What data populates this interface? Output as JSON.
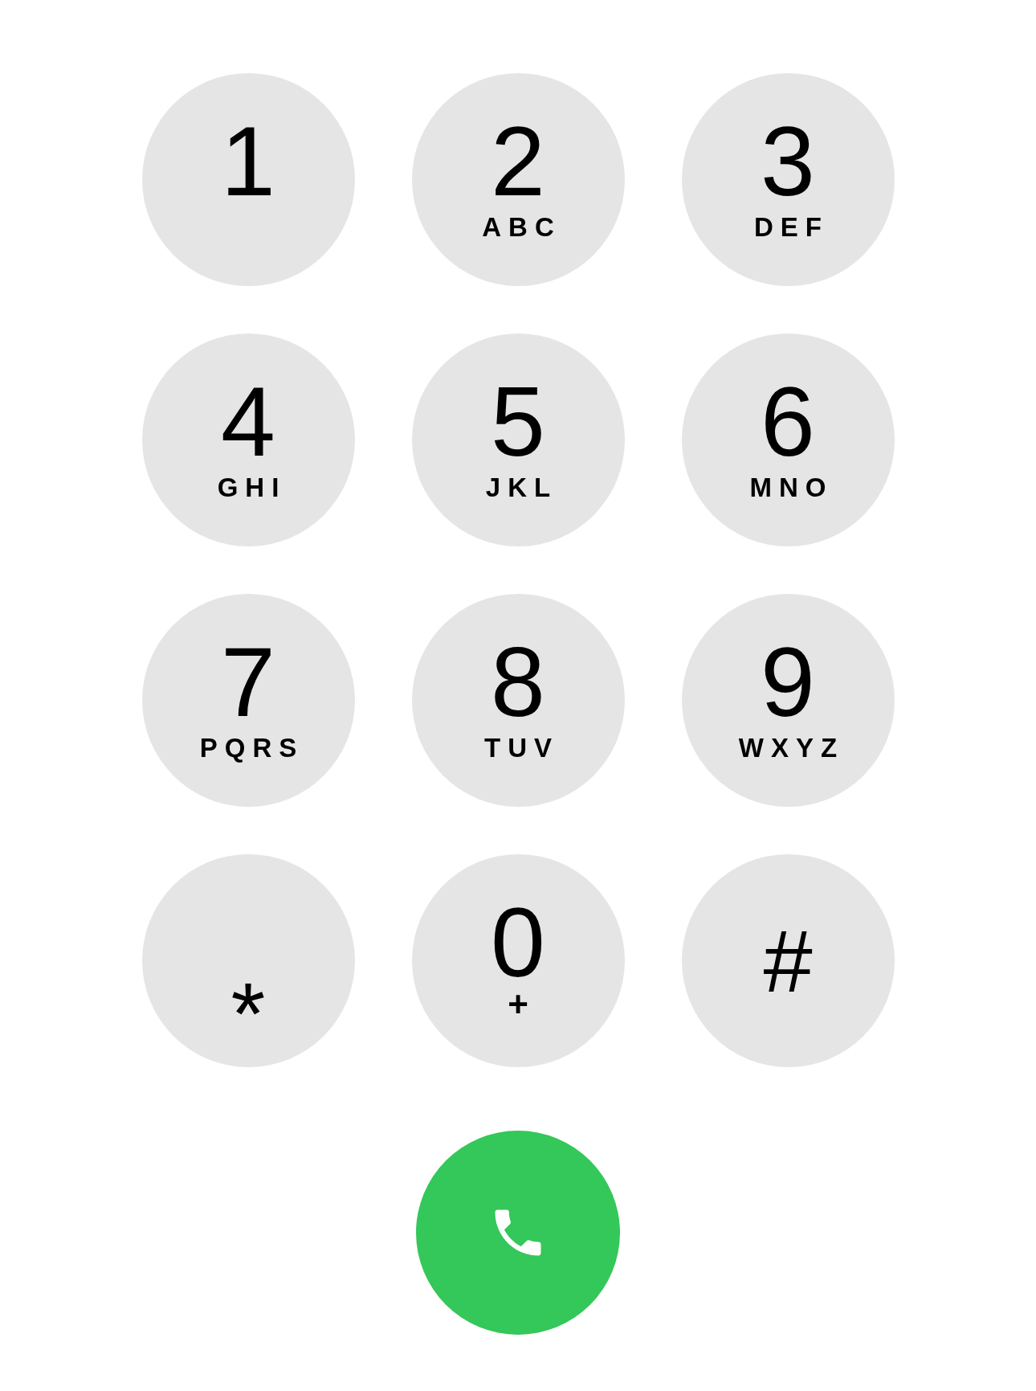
{
  "keypad": {
    "keys": [
      {
        "kind": "digit",
        "digit": "1"
      },
      {
        "kind": "digit",
        "digit": "2",
        "letters": "ABC"
      },
      {
        "kind": "digit",
        "digit": "3",
        "letters": "DEF"
      },
      {
        "kind": "digit",
        "digit": "4",
        "letters": "GHI"
      },
      {
        "kind": "digit",
        "digit": "5",
        "letters": "JKL"
      },
      {
        "kind": "digit",
        "digit": "6",
        "letters": "MNO"
      },
      {
        "kind": "digit",
        "digit": "7",
        "letters": "PQRS"
      },
      {
        "kind": "digit",
        "digit": "8",
        "letters": "TUV"
      },
      {
        "kind": "digit",
        "digit": "9",
        "letters": "WXYZ"
      },
      {
        "kind": "asterisk",
        "digit": "*"
      },
      {
        "kind": "digit",
        "digit": "0",
        "letters": "+"
      },
      {
        "kind": "symbol",
        "digit": "#"
      }
    ]
  }
}
